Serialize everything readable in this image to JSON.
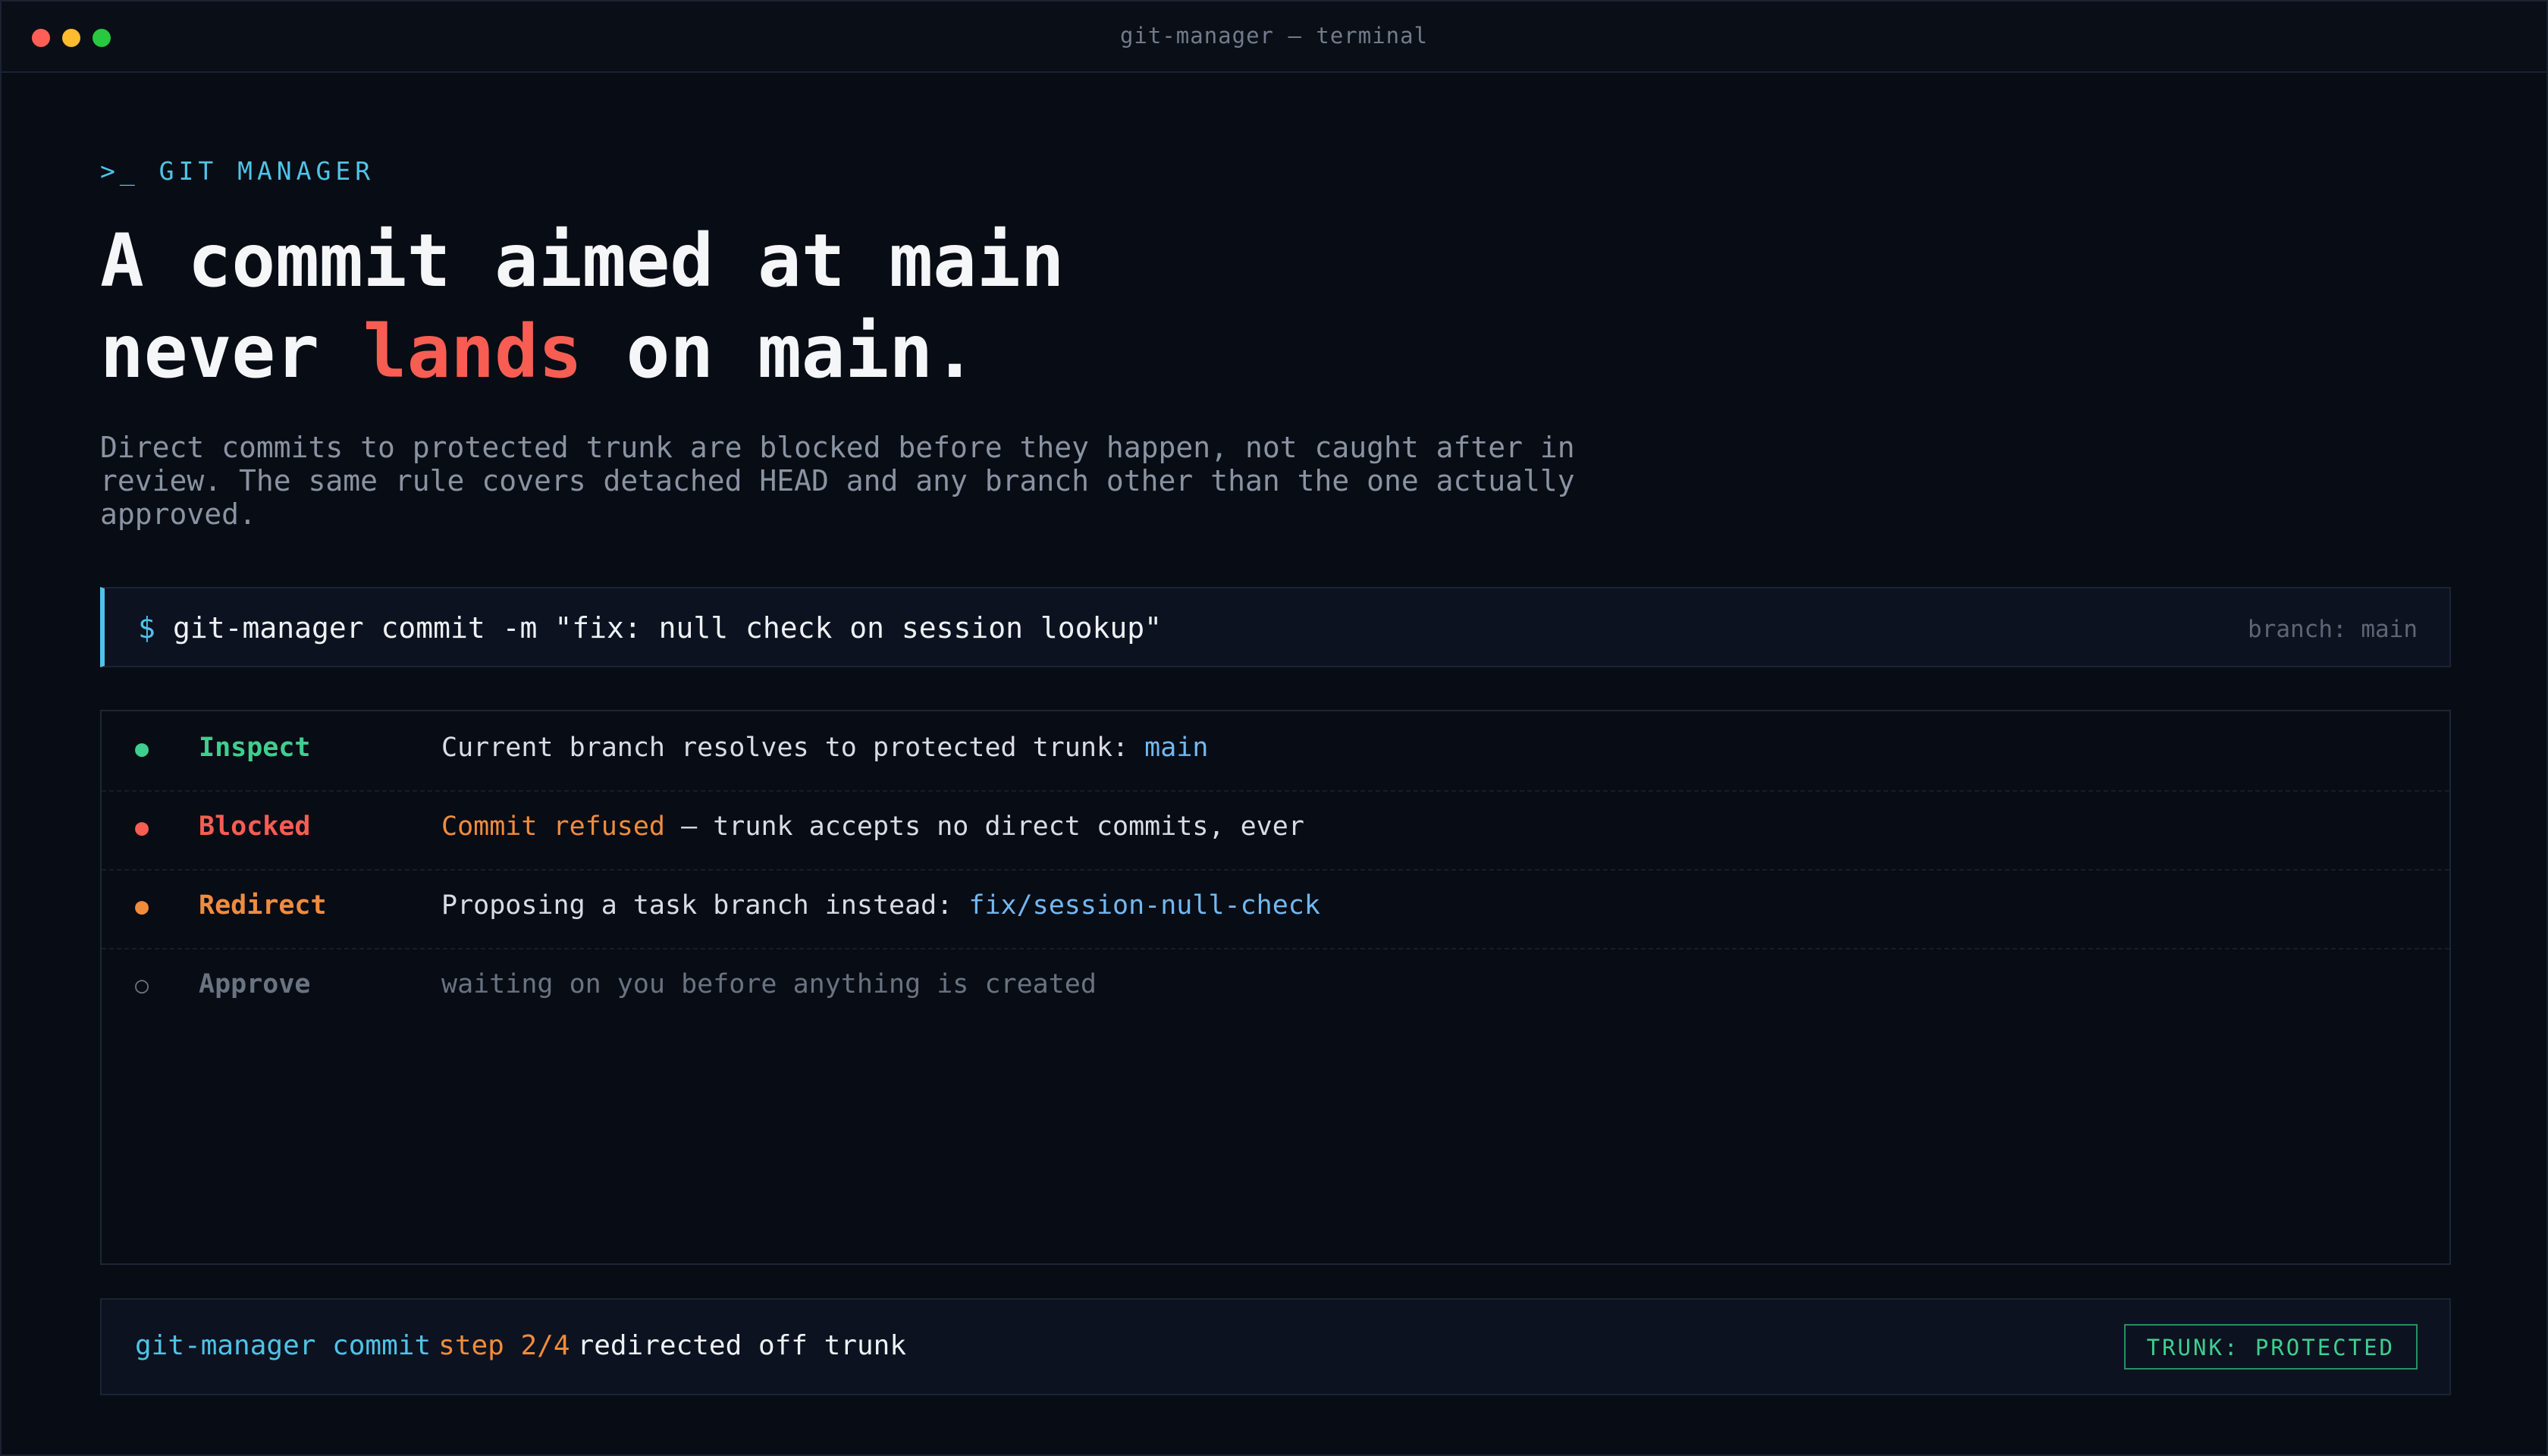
{
  "window": {
    "title": "git-manager — terminal"
  },
  "hero": {
    "eyebrow": ">_ GIT MANAGER",
    "headline_line1": "A commit aimed at main",
    "headline_line2_before": "never ",
    "headline_line2_accent": "lands",
    "headline_line2_after": " on main.",
    "subtext": "Direct commits to protected trunk are blocked before they happen, not caught after in review. The same rule covers detached HEAD and any branch other than the one actually approved."
  },
  "command": {
    "prompt": "$",
    "text": "git-manager commit -m \"fix: null check on session lookup\"",
    "branch_label": "branch: main"
  },
  "steps": [
    {
      "icon": "●",
      "name": "Inspect",
      "desc_before": "Current branch resolves to protected trunk: ",
      "desc_highlight": "main",
      "desc_after": ""
    },
    {
      "icon": "●",
      "name": "Blocked",
      "desc_before": "",
      "desc_highlight": "Commit refused",
      "desc_after": " — trunk accepts no direct commits, ever"
    },
    {
      "icon": "●",
      "name": "Redirect",
      "desc_before": "Proposing a task branch instead: ",
      "desc_highlight": "fix/session-null-check",
      "desc_after": ""
    },
    {
      "icon": "○",
      "name": "Approve",
      "desc_before": "waiting on you before anything is created",
      "desc_highlight": "",
      "desc_after": ""
    }
  ],
  "status": {
    "tool": "git-manager commit",
    "step": "step 2/4",
    "message": "redirected off trunk",
    "badge": "TRUNK: PROTECTED"
  },
  "colors": {
    "accent_cyan": "#4fc3e8",
    "accent_red": "#f75d52",
    "accent_orange": "#f08c3d",
    "accent_green": "#3ecf8e",
    "link_blue": "#72b8f2",
    "background": "#080c14"
  }
}
